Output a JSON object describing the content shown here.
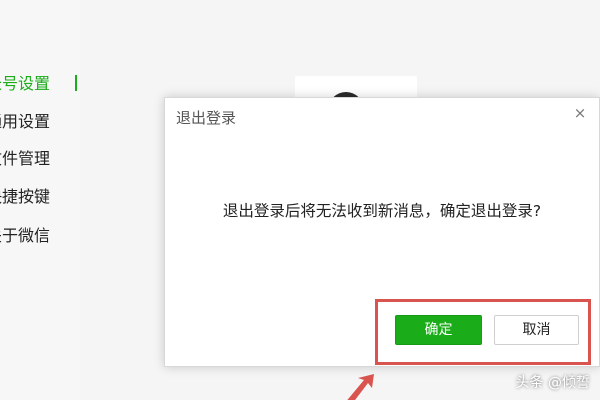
{
  "sidebar": {
    "items": [
      {
        "label": "长号设置",
        "active": true
      },
      {
        "label": "通用设置"
      },
      {
        "label": "文件管理"
      },
      {
        "label": "快捷按键"
      },
      {
        "label": "关于微信"
      }
    ]
  },
  "dialog": {
    "title": "退出登录",
    "close_icon": "×",
    "message": "退出登录后将无法收到新消息，确定退出登录?",
    "ok_label": "确定",
    "cancel_label": "取消"
  },
  "watermark": "头条 @倾誓",
  "colors": {
    "accent": "#1aad19",
    "highlight": "#d9534f"
  }
}
